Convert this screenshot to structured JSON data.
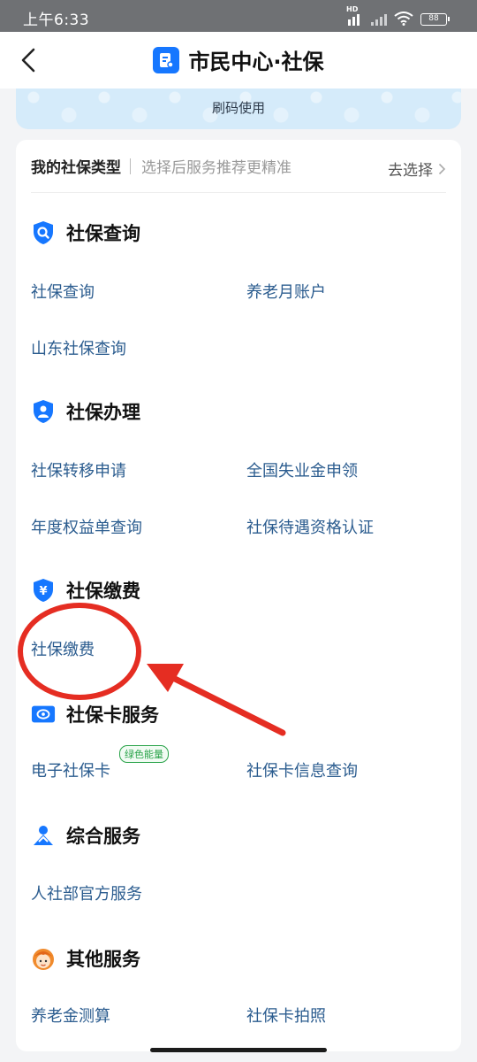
{
  "status_bar": {
    "time": "上午6:33",
    "network_badge": "HD",
    "battery": "88"
  },
  "nav": {
    "title": "市民中心·社保",
    "back_icon": "chevron-left-icon",
    "logo_icon": "citizen-center-logo-icon"
  },
  "banner": {
    "text": "刷码使用"
  },
  "type_selector": {
    "label": "我的社保类型",
    "hint": "选择后服务推荐更精准",
    "action": "去选择"
  },
  "sections": [
    {
      "title": "社保查询",
      "icon": "shield-search-icon",
      "items": [
        "社保查询",
        "养老月账户",
        "山东社保查询"
      ]
    },
    {
      "title": "社保办理",
      "icon": "shield-person-icon",
      "items": [
        "社保转移申请",
        "全国失业金申领",
        "年度权益单查询",
        "社保待遇资格认证"
      ]
    },
    {
      "title": "社保缴费",
      "icon": "shield-yuan-icon",
      "items": [
        "社保缴费"
      ]
    },
    {
      "title": "社保卡服务",
      "icon": "social-card-icon",
      "items": [
        "电子社保卡",
        "社保卡信息查询"
      ],
      "badge": "绿色能量"
    },
    {
      "title": "综合服务",
      "icon": "person-services-icon",
      "items": [
        "人社部官方服务"
      ]
    },
    {
      "title": "其他服务",
      "icon": "avatar-face-icon",
      "items": [
        "养老金测算",
        "社保卡拍照"
      ]
    }
  ],
  "colors": {
    "accent": "#1677ff",
    "link": "#2b5c8f",
    "annotation": "#e52d22",
    "energy_badge": "#2aa34a"
  }
}
